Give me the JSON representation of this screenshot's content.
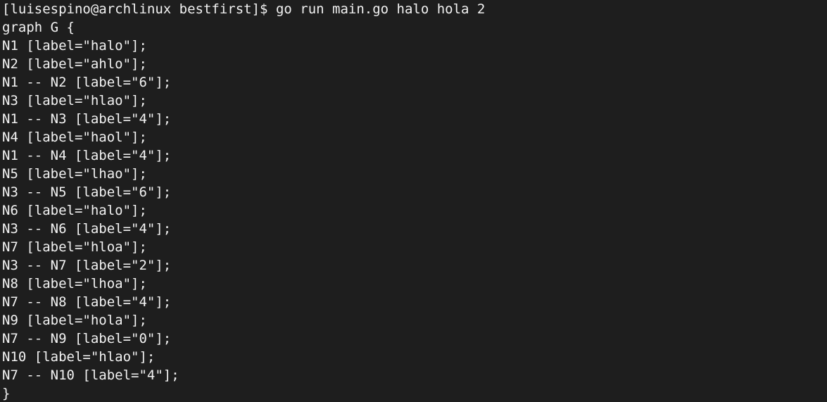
{
  "terminal": {
    "prompt": "[luisespino@archlinux bestfirst]$ ",
    "command": "go run main.go halo hola 2",
    "output_lines": [
      "graph G {",
      "N1 [label=\"halo\"];",
      "N2 [label=\"ahlo\"];",
      "N1 -- N2 [label=\"6\"];",
      "N3 [label=\"hlao\"];",
      "N1 -- N3 [label=\"4\"];",
      "N4 [label=\"haol\"];",
      "N1 -- N4 [label=\"4\"];",
      "N5 [label=\"lhao\"];",
      "N3 -- N5 [label=\"6\"];",
      "N6 [label=\"halo\"];",
      "N3 -- N6 [label=\"4\"];",
      "N7 [label=\"hloa\"];",
      "N3 -- N7 [label=\"2\"];",
      "N8 [label=\"lhoa\"];",
      "N7 -- N8 [label=\"4\"];",
      "N9 [label=\"hola\"];",
      "N7 -- N9 [label=\"0\"];",
      "N10 [label=\"hlao\"];",
      "N7 -- N10 [label=\"4\"];",
      "}"
    ]
  }
}
